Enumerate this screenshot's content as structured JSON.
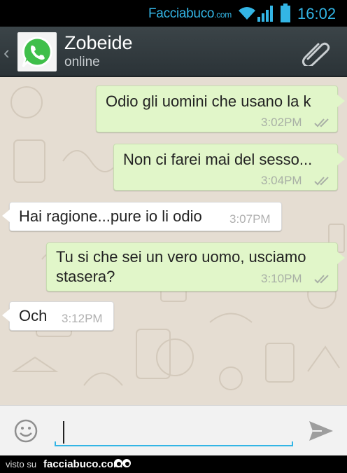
{
  "status_bar": {
    "watermark_main": "Facciabuco",
    "watermark_suffix": ".com",
    "time": "16:02",
    "accent_color": "#33b5e5"
  },
  "action_bar": {
    "contact_name": "Zobeide",
    "status": "online",
    "back_icon": "chevron-left-icon",
    "avatar_icon": "whatsapp-logo",
    "attach_icon": "paperclip-icon"
  },
  "messages": [
    {
      "direction": "outgoing",
      "text": "Odio gli uomini che usano la k",
      "time": "3:02PM",
      "status_icon": "double-check-icon"
    },
    {
      "direction": "outgoing",
      "text": "Non ci farei mai del sesso...",
      "time": "3:04PM",
      "status_icon": "double-check-icon"
    },
    {
      "direction": "incoming",
      "text": "Hai ragione...pure io li odio",
      "time": "3:07PM"
    },
    {
      "direction": "outgoing",
      "text_line1": "Tu si che sei un vero uomo, usciamo",
      "text_line2": "stasera?",
      "time": "3:10PM",
      "status_icon": "double-check-icon"
    },
    {
      "direction": "incoming",
      "text": "Och",
      "time": "3:12PM"
    }
  ],
  "input_bar": {
    "placeholder": "",
    "value": "",
    "emoji_icon": "smiley-icon",
    "send_icon": "send-icon"
  },
  "footer": {
    "visto_su": "visto su",
    "site": "facciabuco.com"
  },
  "colors": {
    "outgoing_bubble": "#e1f6c9",
    "incoming_bubble": "#ffffff",
    "chat_background": "#e5ddd2",
    "action_bar": "#333b3f"
  }
}
